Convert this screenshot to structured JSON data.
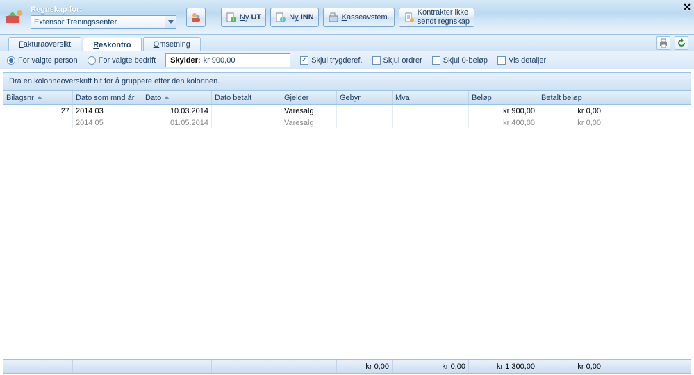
{
  "header": {
    "title": "Regnskap for:",
    "company": "Extensor Treningssenter"
  },
  "toolbar": {
    "ny_ut": "Ny UT",
    "ny_inn": "Ny INN",
    "kasse": "Kasseavstem.",
    "kontrakter_l1": "Kontrakter ikke",
    "kontrakter_l2": "sendt regnskap"
  },
  "tabs": {
    "faktura": "Fakturaoversikt",
    "reskontro": "Reskontro",
    "omsetning": "Omsetning"
  },
  "filter": {
    "valgte_person": "For valgte person",
    "valgte_bedrift": "For valgte bedrift",
    "skylder_label": "Skylder:",
    "skylder_value": "kr 900,00",
    "skjul_trygderef": "Skjul trygderef.",
    "skjul_ordrer": "Skjul ordrer",
    "skjul_0belop": "Skjul 0-beløp",
    "vis_detaljer": "Vis detaljer"
  },
  "groupbar": "Dra en kolonneoverskrift hit for å gruppere etter den kolonnen.",
  "columns": {
    "bilagsnr": "Bilagsnr",
    "dato_mnd": "Dato som mnd år",
    "dato": "Dato",
    "dato_betalt": "Dato betalt",
    "gjelder": "Gjelder",
    "gebyr": "Gebyr",
    "mva": "Mva",
    "belop": "Beløp",
    "betalt_belop": "Betalt beløp"
  },
  "rows": [
    {
      "bilagsnr": "27",
      "dato_mnd": "2014 03",
      "dato": "10.03.2014",
      "dato_betalt": "",
      "gjelder": "Varesalg",
      "gebyr": "",
      "mva": "",
      "belop": "kr 900,00",
      "betalt_belop": "kr 0,00",
      "dim": false
    },
    {
      "bilagsnr": "",
      "dato_mnd": "2014 05",
      "dato": "01.05.2014",
      "dato_betalt": "",
      "gjelder": "Varesalg",
      "gebyr": "",
      "mva": "",
      "belop": "kr 400,00",
      "betalt_belop": "kr 0,00",
      "dim": true
    }
  ],
  "footer": {
    "gebyr": "kr 0,00",
    "mva": "kr 0,00",
    "belop": "kr 1 300,00",
    "betalt_belop": "kr 0,00"
  }
}
